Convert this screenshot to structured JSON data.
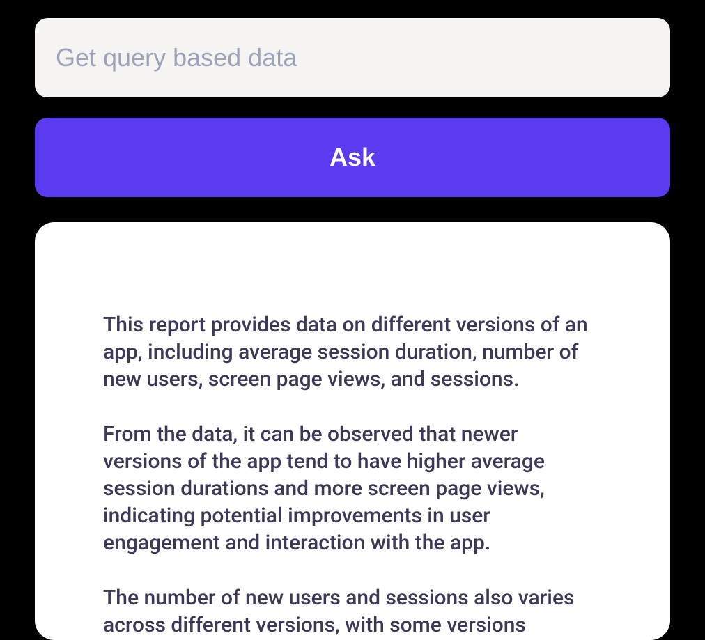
{
  "search": {
    "placeholder": "Get query based data"
  },
  "actions": {
    "ask_label": "Ask"
  },
  "report": {
    "paragraphs": {
      "p1": "This report provides data on different versions of an app, including average session duration, number of new users, screen page views, and sessions.",
      "p2": "From the data, it can be observed that newer versions of the app tend to have higher average session durations and more screen page views, indicating potential improvements in user engagement and interaction with the app.",
      "p3": "The number of new users and sessions also varies across different versions, with some versions"
    }
  }
}
